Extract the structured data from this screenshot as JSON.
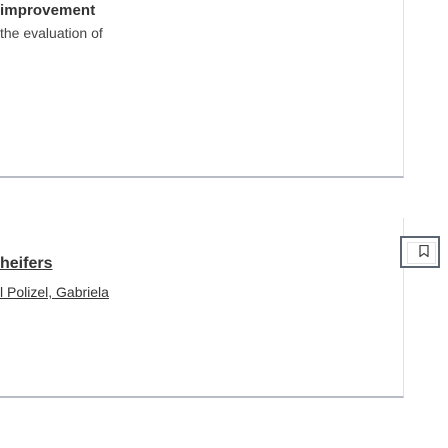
{
  "card_top": {
    "title": "improvement",
    "text": "the evaluation of"
  },
  "card_bottom": {
    "title": "heifers",
    "authors": "l Polizel, Gabriela"
  },
  "side_button": {
    "icon": "bookmark-icon"
  },
  "colors": {
    "border": "#5b6473",
    "divider": "#b7bcc5",
    "text": "#333333"
  }
}
